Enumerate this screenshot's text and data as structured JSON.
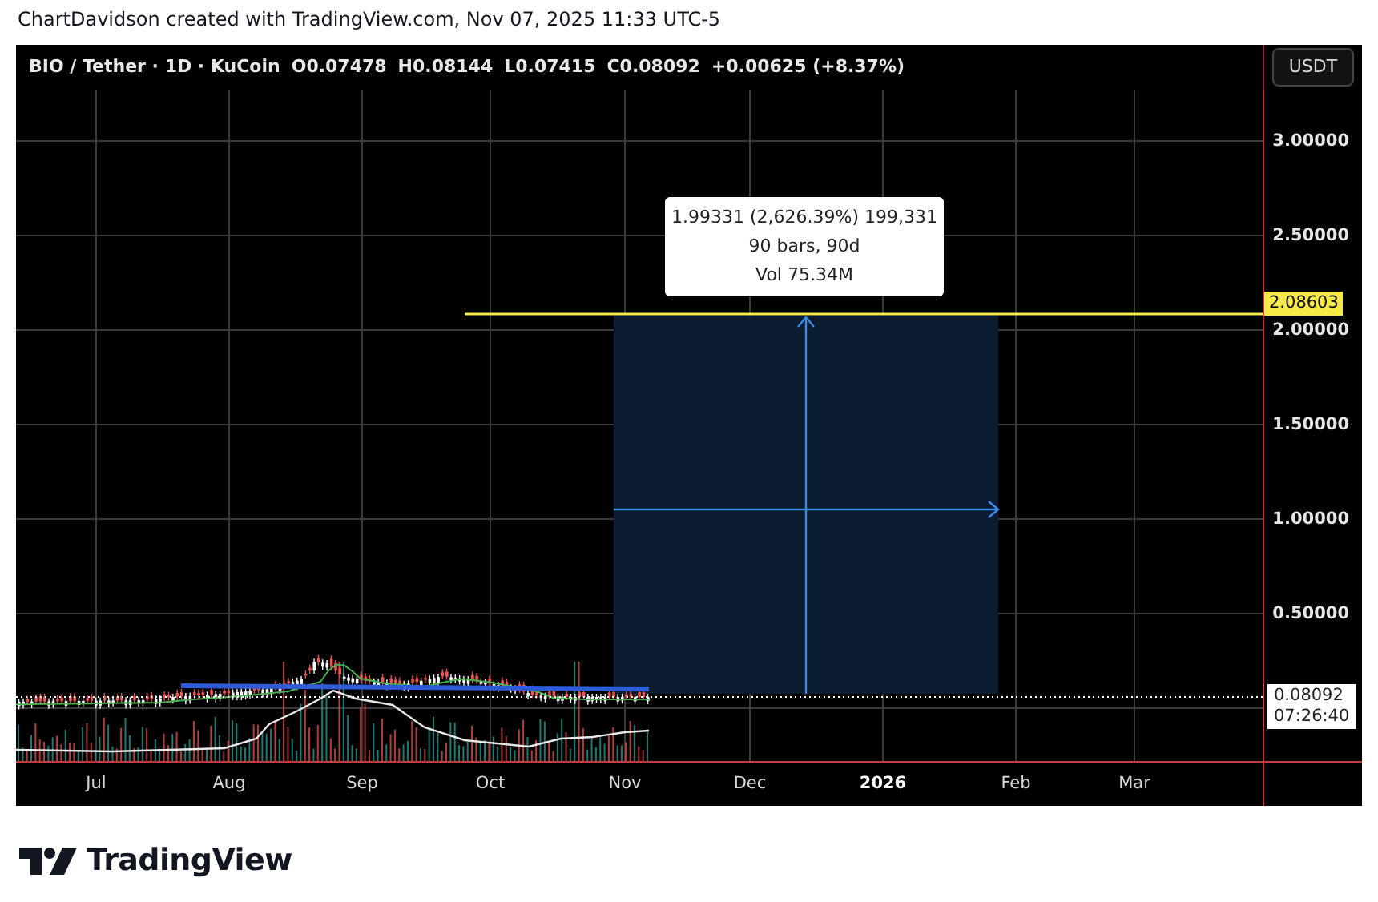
{
  "caption": "ChartDavidson created with TradingView.com, Nov 07, 2025 11:33 UTC-5",
  "legend": {
    "symbol": "BIO / Tether · 1D · KuCoin",
    "open": "O0.07478",
    "high": "H0.08144",
    "low": "L0.07415",
    "close": "C0.08092",
    "change": "+0.00625 (+8.37%)"
  },
  "currency_button": "USDT",
  "price_axis": [
    "3.00000",
    "2.50000",
    "2.00000",
    "1.50000",
    "1.00000",
    "0.50000"
  ],
  "price_line_label": "2.08603",
  "last_price": {
    "price": "0.08092",
    "countdown": "07:26:40"
  },
  "measure": {
    "lines": [
      "1.99331 (2,626.39%) 199,331",
      "90 bars, 90d",
      "Vol 75.34M"
    ]
  },
  "time_axis": [
    {
      "label": "Jul",
      "bold": false
    },
    {
      "label": "Aug",
      "bold": false
    },
    {
      "label": "Sep",
      "bold": false
    },
    {
      "label": "Oct",
      "bold": false
    },
    {
      "label": "Nov",
      "bold": false
    },
    {
      "label": "Dec",
      "bold": false
    },
    {
      "label": "2026",
      "bold": true
    },
    {
      "label": "Feb",
      "bold": false
    },
    {
      "label": "Mar",
      "bold": false
    }
  ],
  "logo": "TradingView"
}
